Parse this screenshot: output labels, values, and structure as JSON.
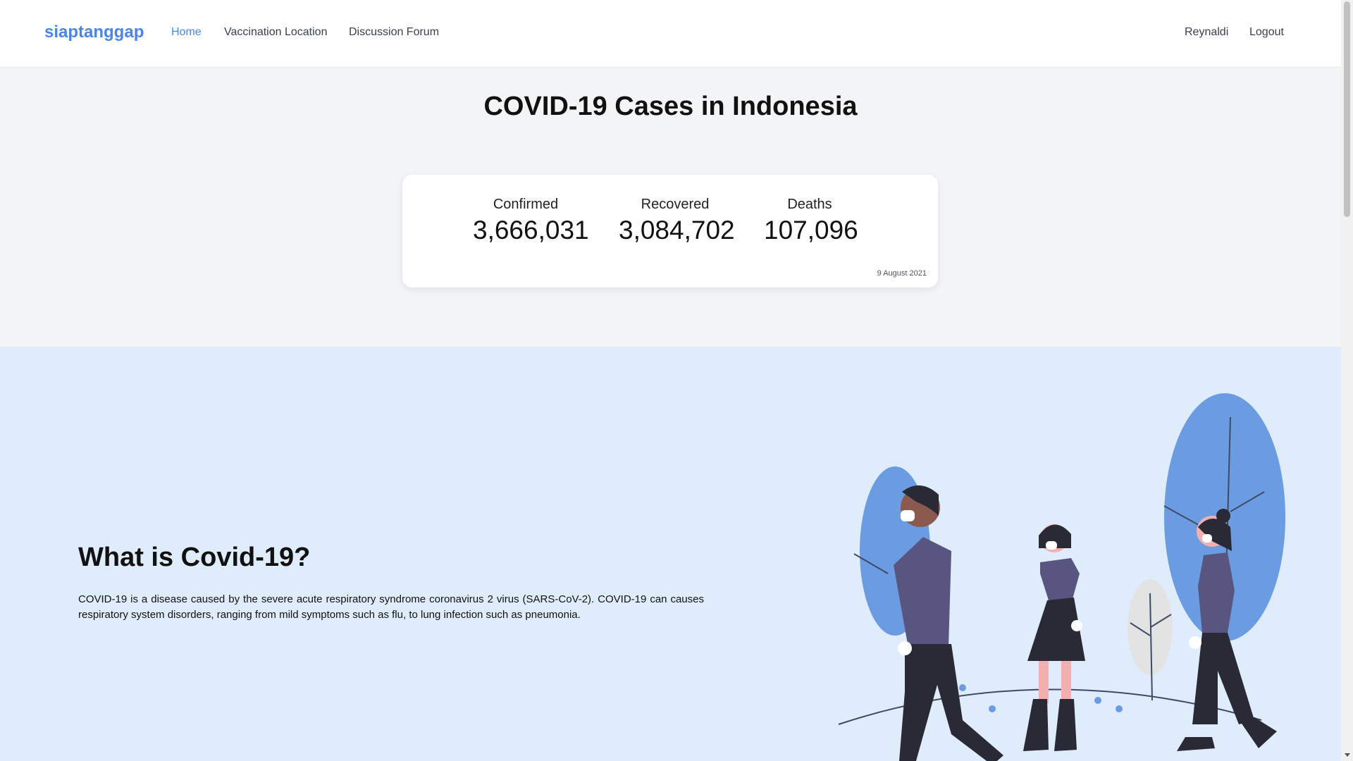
{
  "nav": {
    "brand": "siaptanggap",
    "links": [
      "Home",
      "Vaccination Location",
      "Discussion Forum"
    ],
    "user": "Reynaldi",
    "logout": "Logout"
  },
  "cases": {
    "title": "COVID-19 Cases in Indonesia",
    "stats": [
      {
        "label": "Confirmed",
        "value": "3,666,031"
      },
      {
        "label": "Recovered",
        "value": "3,084,702"
      },
      {
        "label": "Deaths",
        "value": "107,096"
      }
    ],
    "date": "9 August 2021"
  },
  "about": {
    "title": "What is Covid-19?",
    "text": "COVID-19 is a disease caused by the severe acute respiratory syndrome coronavirus 2 virus (SARS-CoV-2). COVID-19 can causes respiratory system disorders, ranging from mild symptoms such as flu, to lung infection such as pneumonia."
  },
  "colors": {
    "accent": "#4a86e8",
    "about_bg": "#dfecfc",
    "tree_blue": "#6b9be0",
    "coat_purple": "#585680",
    "dark": "#2a2936"
  },
  "illustration": "people-walking-with-masks"
}
